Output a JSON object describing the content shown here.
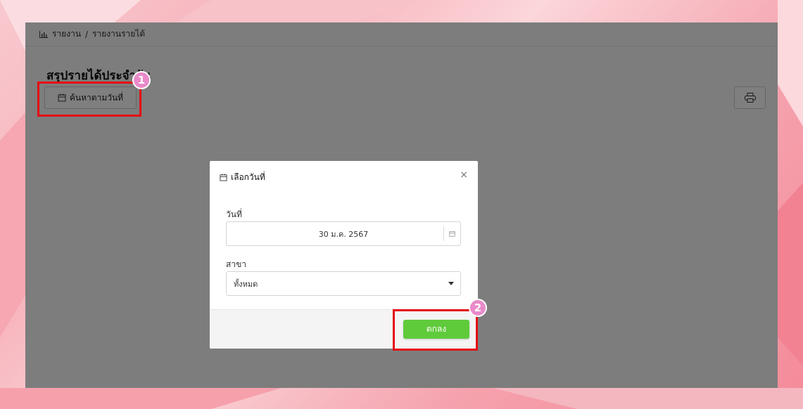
{
  "breadcrumb": {
    "icon": "bar-chart-icon",
    "root": "รายงาน",
    "separator": "/",
    "current": "รายงานรายได้"
  },
  "page": {
    "title": "สรุปรายได้ประจำวัน",
    "search_button_label": "ค้นหาตามวันที่",
    "print_icon": "printer-icon"
  },
  "modal": {
    "title": "เลือกวันที่",
    "close_icon": "close-icon",
    "date_label": "วันที่",
    "date_value": "30 ม.ค. 2567",
    "branch_label": "สาขา",
    "branch_value": "ทั้งหมด",
    "ok_label": "ตกลง"
  },
  "annotations": {
    "step1": "1",
    "step2": "2"
  },
  "colors": {
    "highlight": "#e50914",
    "badge": "#e98ac9",
    "ok_button": "#5fcb3b"
  }
}
